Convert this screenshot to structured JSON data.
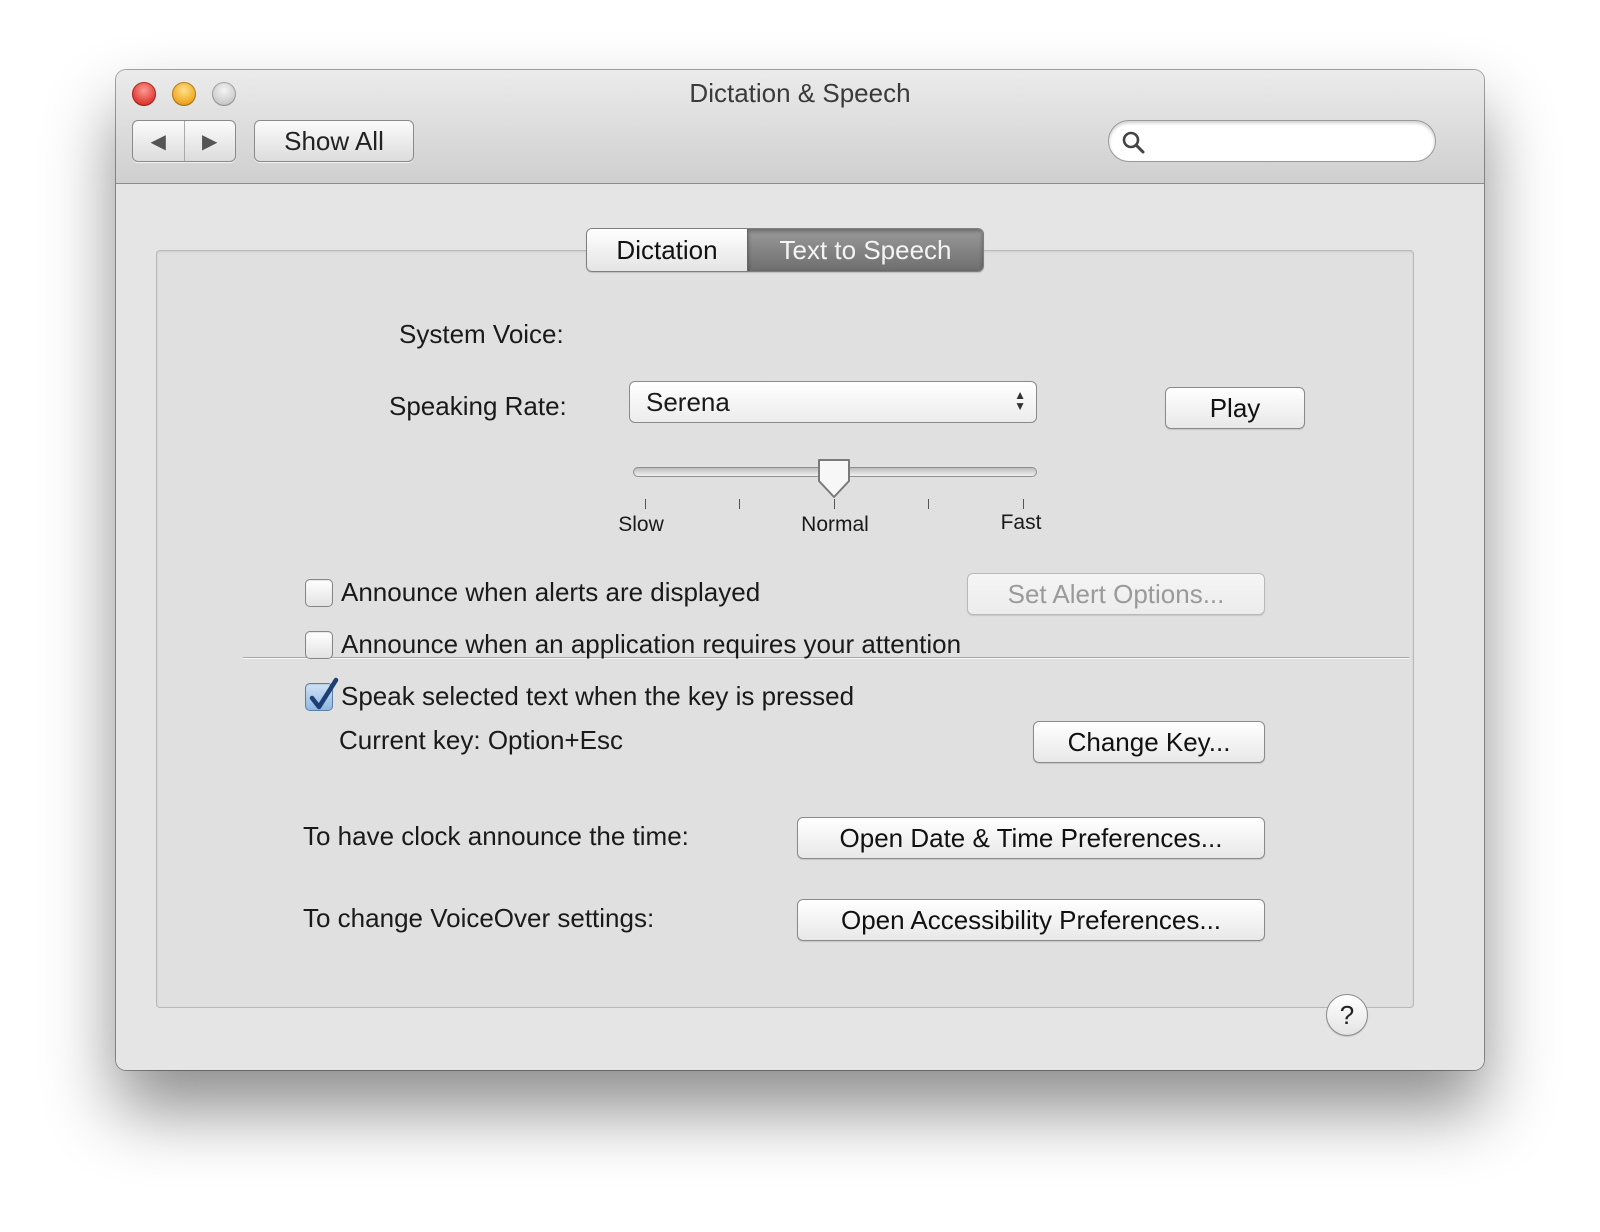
{
  "window": {
    "title": "Dictation & Speech"
  },
  "toolbar": {
    "back_glyph": "◀",
    "forward_glyph": "▶",
    "show_all_label": "Show All",
    "search_value": "",
    "search_icon": "search-icon"
  },
  "tabs": [
    {
      "label": "Dictation",
      "selected": false
    },
    {
      "label": "Text to Speech",
      "selected": true
    }
  ],
  "voice": {
    "label": "System Voice:",
    "selected": "Serena"
  },
  "rate": {
    "label": "Speaking Rate:",
    "value_fraction": 0.5,
    "tick_labels": [
      "Slow",
      "Normal",
      "Fast"
    ]
  },
  "play_label": "Play",
  "options": [
    {
      "label": "Announce when alerts are displayed",
      "checked": false
    },
    {
      "label": "Announce when an application requires your attention",
      "checked": false
    },
    {
      "label": "Speak selected text when the key is pressed",
      "checked": true
    }
  ],
  "set_alert_label": "Set Alert Options...",
  "current_key_text": "Current key: Option+Esc",
  "change_key_label": "Change Key...",
  "clock_label": "To have clock announce the time:",
  "date_time_button": "Open Date & Time Preferences...",
  "voiceover_label": "To change VoiceOver settings:",
  "accessibility_button": "Open Accessibility Preferences...",
  "help_glyph": "?"
}
